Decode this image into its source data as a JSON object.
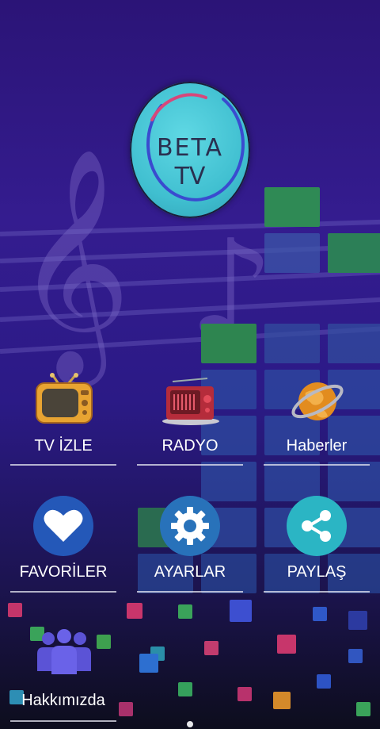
{
  "logo": {
    "line1": "BETA",
    "line2": "TV"
  },
  "menu": [
    {
      "label": "TV İZLE",
      "icon": "tv-icon"
    },
    {
      "label": "RADYO",
      "icon": "radio-icon"
    },
    {
      "label": "Haberler",
      "icon": "globe-icon"
    },
    {
      "label": "FAVORİLER",
      "icon": "heart-icon"
    },
    {
      "label": "AYARLAR",
      "icon": "gear-icon"
    },
    {
      "label": "PAYLAŞ",
      "icon": "share-icon"
    },
    {
      "label": "Hakkımızda",
      "icon": "users-icon"
    }
  ],
  "colors": {
    "favorites_circle": "#2458b8",
    "settings_circle": "#2872ba",
    "share_circle": "#2bb5c4",
    "about_icon": "#5b53d6"
  }
}
